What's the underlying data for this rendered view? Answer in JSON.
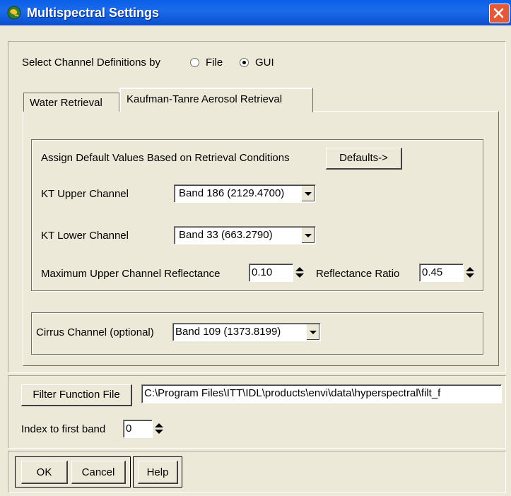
{
  "window": {
    "title": "Multispectral Settings",
    "title_icon": "globe-app-icon",
    "close_icon": "close-icon",
    "title_bar_color": "#0A5FE8",
    "close_color": "#E45A38"
  },
  "channel_source": {
    "label": "Select Channel Definitions by",
    "options": [
      "File",
      "GUI"
    ],
    "selected": "GUI"
  },
  "tabs": [
    {
      "label": "Water Retrieval",
      "active": false
    },
    {
      "label": "Kaufman-Tanre Aerosol Retrieval",
      "active": true
    }
  ],
  "kt": {
    "defaults_label": "Assign Default Values Based on Retrieval Conditions",
    "defaults_button": "Defaults->",
    "upper_label": "KT Upper Channel",
    "upper_value": "Band 186 (2129.4700)",
    "lower_label": "KT Lower Channel",
    "lower_value": "Band 33 (663.2790)",
    "max_refl_label": "Maximum Upper Channel Reflectance",
    "max_refl_value": "0.10",
    "ratio_label": "Reflectance Ratio",
    "ratio_value": "0.45"
  },
  "cirrus": {
    "label": "Cirrus Channel (optional)",
    "value": "Band 109 (1373.8199)"
  },
  "filter": {
    "button": "Filter Function File",
    "path": "C:\\Program Files\\ITT\\IDL\\products\\envi\\data\\hyperspectral\\filt_f",
    "index_label": "Index to first band",
    "index_value": "0"
  },
  "buttons": {
    "ok": "OK",
    "cancel": "Cancel",
    "help": "Help"
  }
}
